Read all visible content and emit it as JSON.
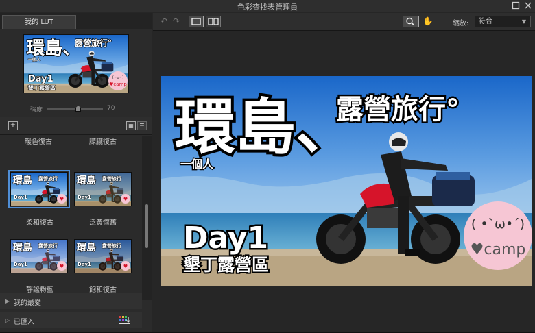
{
  "window": {
    "title": "色彩查找表管理員",
    "maximize_icon": "maximize-icon",
    "close_icon": "close-icon"
  },
  "left_panel": {
    "tab_label": "我的 LUT",
    "strength": {
      "label": "強度",
      "value": "70",
      "level_percent": 70
    },
    "toolbar": {
      "add_icon": "add-icon",
      "grid_view_icon": "grid-view-icon",
      "list_view_icon": "list-view-icon"
    },
    "top_captions": [
      "暖色復古",
      "朦朧復古"
    ],
    "presets": [
      {
        "name": "柔和復古",
        "selected": true
      },
      {
        "name": "泛黃懷舊",
        "selected": false
      },
      {
        "name": "靜謐粉藍",
        "selected": false
      },
      {
        "name": "飽和復古",
        "selected": false
      }
    ],
    "sections": [
      {
        "label": "我的最愛"
      },
      {
        "label": "已匯入"
      }
    ]
  },
  "toolbar": {
    "undo_icon": "undo-icon",
    "redo_icon": "redo-icon",
    "single_view_icon": "single-view-icon",
    "compare_view_icon": "split-view-icon",
    "zoom_tool_icon": "magnifier-icon",
    "pan_tool_icon": "hand-icon",
    "zoom_label": "縮放:",
    "zoom_value": "符合"
  },
  "image": {
    "title_big": "環島、",
    "title_side": "露營旅行°",
    "subtitle": "一個人",
    "day": "Day1",
    "location": "墾丁露營區",
    "badge_face": "( •`ω•´)",
    "badge_text": "♥camp",
    "mini_face": "(•ω•)",
    "mini_badge": "♥camp"
  },
  "colors": {
    "accent": "#4f8ed6",
    "panel": "#2b2b2b",
    "badge_pink": "#f6c6d4",
    "heart_red": "#d6142a"
  }
}
